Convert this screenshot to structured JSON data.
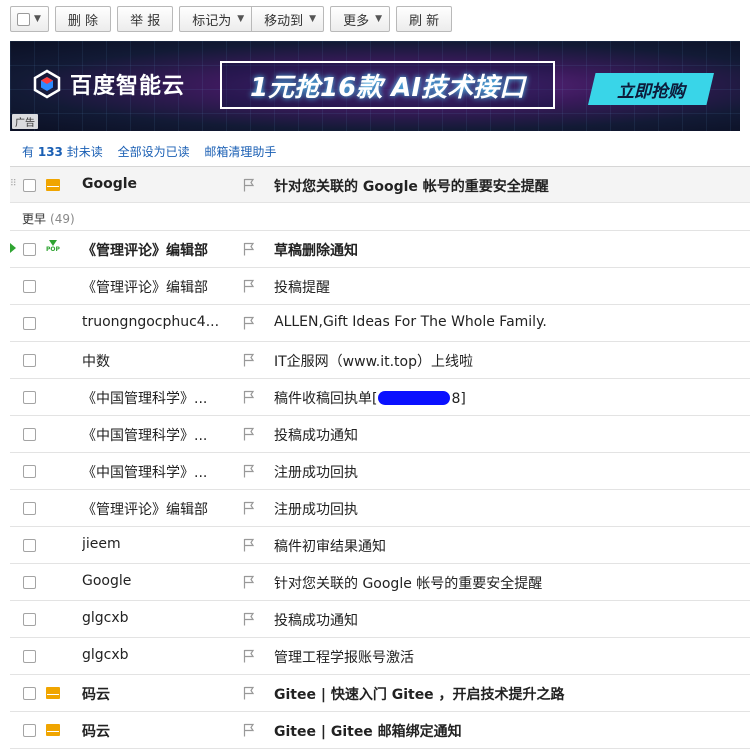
{
  "toolbar": {
    "delete_label": "删 除",
    "report_label": "举 报",
    "mark_as_label": "标记为",
    "move_to_label": "移动到",
    "more_label": "更多",
    "refresh_label": "刷 新"
  },
  "banner": {
    "brand": "百度智能云",
    "promo": "1元抢16款 AI技术接口",
    "cta": "立即抢购",
    "ad_tag": "广告"
  },
  "summary": {
    "prefix": "有",
    "count": "133",
    "suffix": "封未读",
    "mark_all_read": "全部设为已读",
    "cleanup_helper": "邮箱清理助手"
  },
  "pinned": {
    "sender": "Google",
    "subject": "针对您关联的 Google 帐号的重要安全提醒",
    "icon": "envelope-icon",
    "unread": true
  },
  "group": {
    "label": "更早",
    "count": "(49)"
  },
  "messages": [
    {
      "sender": "《管理评论》编辑部",
      "subject": "草稿删除通知",
      "icon": "pop-download-icon",
      "unread": true
    },
    {
      "sender": "《管理评论》编辑部",
      "subject": "投稿提醒",
      "icon": "",
      "unread": false
    },
    {
      "sender": "truongngocphuc4...",
      "subject": "ALLEN,Gift Ideas For The Whole Family.",
      "icon": "",
      "unread": false
    },
    {
      "sender": "中数",
      "subject": "IT企服网（www.it.top）上线啦",
      "icon": "",
      "unread": false
    },
    {
      "sender": "《中国管理科学》...",
      "subject_prefix": "稿件收稿回执单[",
      "subject_suffix": "8]",
      "icon": "",
      "unread": false
    },
    {
      "sender": "《中国管理科学》...",
      "subject": "投稿成功通知",
      "icon": "",
      "unread": false
    },
    {
      "sender": "《中国管理科学》...",
      "subject": "注册成功回执",
      "icon": "",
      "unread": false
    },
    {
      "sender": "《管理评论》编辑部",
      "subject": "注册成功回执",
      "icon": "",
      "unread": false
    },
    {
      "sender": "jieem",
      "subject": "稿件初审结果通知",
      "icon": "",
      "unread": false
    },
    {
      "sender": "Google",
      "subject": "针对您关联的 Google 帐号的重要安全提醒",
      "icon": "",
      "unread": false
    },
    {
      "sender": "glgcxb",
      "subject": "投稿成功通知",
      "icon": "",
      "unread": false
    },
    {
      "sender": "glgcxb",
      "subject": "管理工程学报账号激活",
      "icon": "",
      "unread": false
    },
    {
      "sender": "码云",
      "subject": "Gitee | 快速入门 Gitee ，开启技术提升之路",
      "icon": "envelope-icon",
      "unread": true
    },
    {
      "sender": "码云",
      "subject": "Gitee | Gitee 邮箱绑定通知",
      "icon": "envelope-icon",
      "unread": true
    }
  ],
  "colors": {
    "link": "#1a5fb4",
    "envelope": "#f0a500",
    "pop_icon": "#2fa432",
    "redaction": "#0a10ff"
  }
}
